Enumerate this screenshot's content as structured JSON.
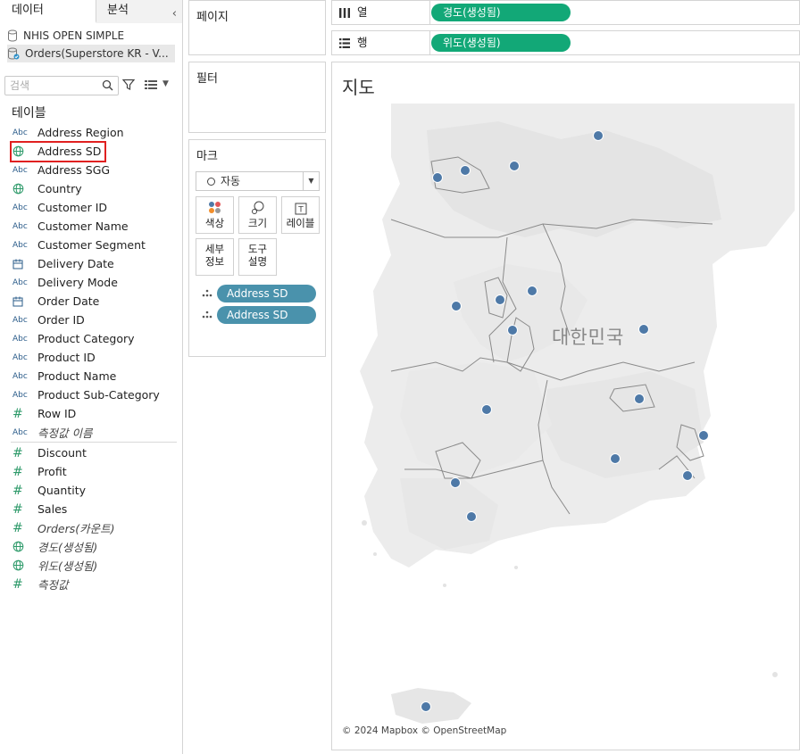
{
  "tabs": {
    "data": "데이터",
    "analytics": "분석"
  },
  "datasources": [
    {
      "name": "NHIS OPEN SIMPLE"
    },
    {
      "name": "Orders(Superstore KR - V..."
    }
  ],
  "search": {
    "placeholder": "검색"
  },
  "section_title": "테이블",
  "fields": [
    {
      "icon": "Abc",
      "name": "Address Region",
      "italic": false
    },
    {
      "icon": "globe",
      "name": "Address SD",
      "italic": false
    },
    {
      "icon": "Abc",
      "name": "Address SGG",
      "italic": false
    },
    {
      "icon": "globe",
      "name": "Country",
      "italic": false
    },
    {
      "icon": "Abc",
      "name": "Customer ID",
      "italic": false
    },
    {
      "icon": "Abc",
      "name": "Customer Name",
      "italic": false
    },
    {
      "icon": "Abc",
      "name": "Customer Segment",
      "italic": false
    },
    {
      "icon": "calendar",
      "name": "Delivery Date",
      "italic": false
    },
    {
      "icon": "Abc",
      "name": "Delivery Mode",
      "italic": false
    },
    {
      "icon": "calendar",
      "name": "Order Date",
      "italic": false
    },
    {
      "icon": "Abc",
      "name": "Order ID",
      "italic": false
    },
    {
      "icon": "Abc",
      "name": "Product Category",
      "italic": false
    },
    {
      "icon": "Abc",
      "name": "Product ID",
      "italic": false
    },
    {
      "icon": "Abc",
      "name": "Product Name",
      "italic": false
    },
    {
      "icon": "Abc",
      "name": "Product Sub-Category",
      "italic": false
    },
    {
      "icon": "#",
      "name": "Row ID",
      "italic": false
    },
    {
      "icon": "Abc",
      "name": "측정값 이름",
      "italic": true
    }
  ],
  "measures": [
    {
      "icon": "#",
      "name": "Discount",
      "italic": false
    },
    {
      "icon": "#",
      "name": "Profit",
      "italic": false
    },
    {
      "icon": "#",
      "name": "Quantity",
      "italic": false
    },
    {
      "icon": "#",
      "name": "Sales",
      "italic": false
    },
    {
      "icon": "#",
      "name": "Orders(카운트)",
      "italic": true
    },
    {
      "icon": "globe",
      "name": "경도(생성됨)",
      "italic": true
    },
    {
      "icon": "globe",
      "name": "위도(생성됨)",
      "italic": true
    },
    {
      "icon": "#",
      "name": "측정값",
      "italic": true
    }
  ],
  "cards": {
    "pages": "페이지",
    "filters": "필터",
    "marks": "마크",
    "mark_type": "자동",
    "buttons": {
      "color": "색상",
      "size": "크기",
      "label": "레이블",
      "detail_1": "세부",
      "detail_2": "정보",
      "tooltip_1": "도구",
      "tooltip_2": "설명"
    },
    "mark_pills": [
      "Address SD",
      "Address SD"
    ]
  },
  "shelves": {
    "columns_label": "열",
    "columns_pill": "경도(생성됨)",
    "rows_label": "행",
    "rows_pill": "위도(생성됨)"
  },
  "view": {
    "title": "지도",
    "country_label": "대한민국",
    "attribution": "© 2024 Mapbox © OpenStreetMap",
    "dot_color": "#4e79a7"
  },
  "colors": {
    "pill_blue": "#4a92ac",
    "pill_green": "#12a877",
    "highlight": "#e02020"
  }
}
